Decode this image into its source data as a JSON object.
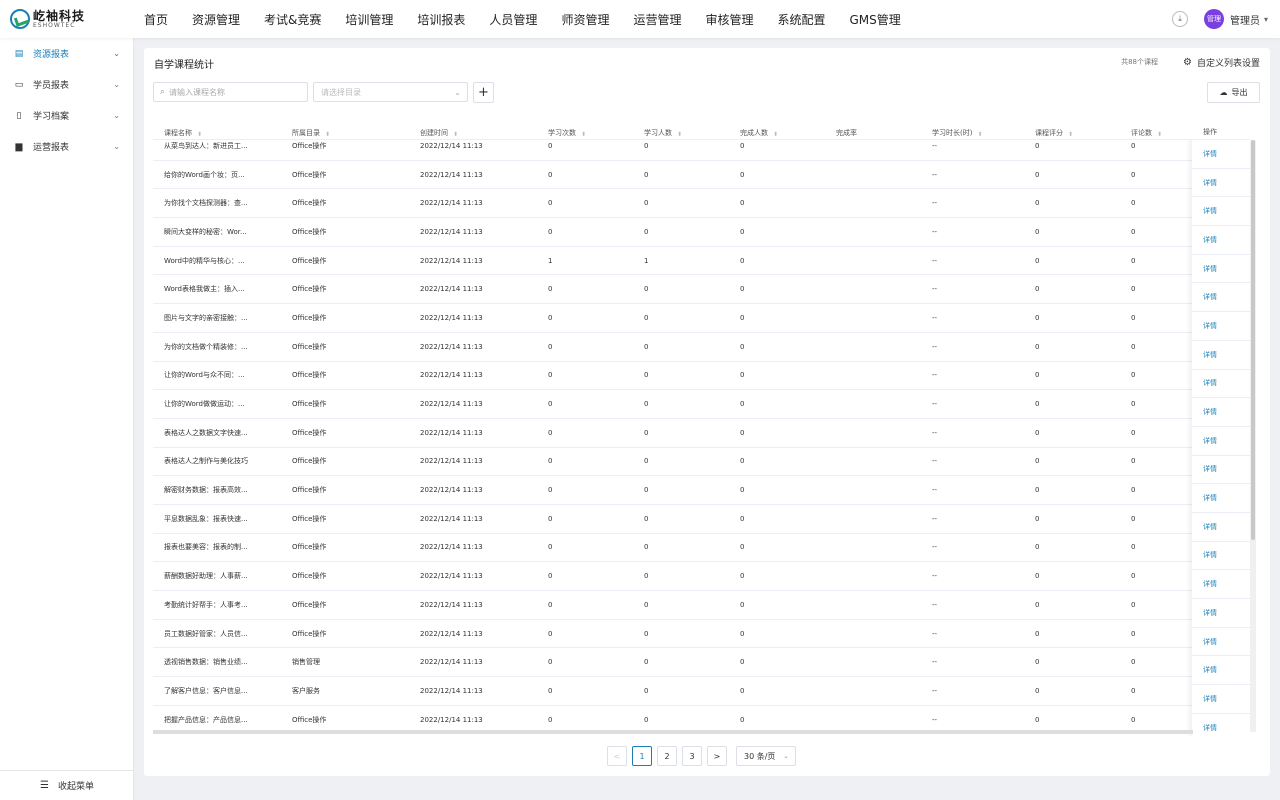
{
  "brand": {
    "name_cn": "屹袖科技",
    "name_en": "ESHOWTEC"
  },
  "nav": [
    "首页",
    "资源管理",
    "考试&竞赛",
    "培训管理",
    "培训报表",
    "人员管理",
    "师资管理",
    "运营管理",
    "审核管理",
    "系统配置",
    "GMS管理"
  ],
  "user": {
    "avatar_text": "管理",
    "name": "管理员"
  },
  "sidebar": {
    "items": [
      {
        "label": "资源报表",
        "icon": "document-icon",
        "active": true
      },
      {
        "label": "学员报表",
        "icon": "id-card-icon",
        "active": false
      },
      {
        "label": "学习档案",
        "icon": "file-icon",
        "active": false
      },
      {
        "label": "运营报表",
        "icon": "bar-chart-icon",
        "active": false
      }
    ],
    "collapse_label": "收起菜单"
  },
  "card": {
    "title": "自学课程统计",
    "total": "共88个课程",
    "custom_columns": "自定义列表设置",
    "search_placeholder": "请输入课程名称",
    "category_placeholder": "请选择目录",
    "export_label": "导出"
  },
  "table": {
    "columns": [
      "课程名称",
      "所属目录",
      "创建时间",
      "学习次数",
      "学习人数",
      "完成人数",
      "完成率",
      "学习时长(时)",
      "课程评分",
      "评论数"
    ],
    "operation_header": "操作",
    "detail_label": "详情",
    "rows": [
      [
        "从菜鸟到达人：新进员工...",
        "Office操作",
        "2022/12/14 11:13",
        "0",
        "0",
        "0",
        "",
        "--",
        "0",
        "0"
      ],
      [
        "给你的Word画个妆：页...",
        "Office操作",
        "2022/12/14 11:13",
        "0",
        "0",
        "0",
        "",
        "--",
        "0",
        "0"
      ],
      [
        "为你找个文档探测器：查...",
        "Office操作",
        "2022/12/14 11:13",
        "0",
        "0",
        "0",
        "",
        "--",
        "0",
        "0"
      ],
      [
        "瞬间大变样的秘密：Wor...",
        "Office操作",
        "2022/12/14 11:13",
        "0",
        "0",
        "0",
        "",
        "--",
        "0",
        "0"
      ],
      [
        "Word中的精华与核心：...",
        "Office操作",
        "2022/12/14 11:13",
        "1",
        "1",
        "0",
        "",
        "--",
        "0",
        "0"
      ],
      [
        "Word表格我做主：插入...",
        "Office操作",
        "2022/12/14 11:13",
        "0",
        "0",
        "0",
        "",
        "--",
        "0",
        "0"
      ],
      [
        "图片与文字的亲密接触：...",
        "Office操作",
        "2022/12/14 11:13",
        "0",
        "0",
        "0",
        "",
        "--",
        "0",
        "0"
      ],
      [
        "为你的文档做个精装修：...",
        "Office操作",
        "2022/12/14 11:13",
        "0",
        "0",
        "0",
        "",
        "--",
        "0",
        "0"
      ],
      [
        "让你的Word与众不同：...",
        "Office操作",
        "2022/12/14 11:13",
        "0",
        "0",
        "0",
        "",
        "--",
        "0",
        "0"
      ],
      [
        "让你的Word做做运动：...",
        "Office操作",
        "2022/12/14 11:13",
        "0",
        "0",
        "0",
        "",
        "--",
        "0",
        "0"
      ],
      [
        "表格达人之数据文字快速...",
        "Office操作",
        "2022/12/14 11:13",
        "0",
        "0",
        "0",
        "",
        "--",
        "0",
        "0"
      ],
      [
        "表格达人之制作与美化技巧",
        "Office操作",
        "2022/12/14 11:13",
        "0",
        "0",
        "0",
        "",
        "--",
        "0",
        "0"
      ],
      [
        "解密财务数据：报表高效...",
        "Office操作",
        "2022/12/14 11:13",
        "0",
        "0",
        "0",
        "",
        "--",
        "0",
        "0"
      ],
      [
        "平息数据乱象：报表快速...",
        "Office操作",
        "2022/12/14 11:13",
        "0",
        "0",
        "0",
        "",
        "--",
        "0",
        "0"
      ],
      [
        "报表也要美容：报表的制...",
        "Office操作",
        "2022/12/14 11:13",
        "0",
        "0",
        "0",
        "",
        "--",
        "0",
        "0"
      ],
      [
        "薪酬数据好助理：人事薪...",
        "Office操作",
        "2022/12/14 11:13",
        "0",
        "0",
        "0",
        "",
        "--",
        "0",
        "0"
      ],
      [
        "考勤统计好帮手：人事考...",
        "Office操作",
        "2022/12/14 11:13",
        "0",
        "0",
        "0",
        "",
        "--",
        "0",
        "0"
      ],
      [
        "员工数据好管家：人员信...",
        "Office操作",
        "2022/12/14 11:13",
        "0",
        "0",
        "0",
        "",
        "--",
        "0",
        "0"
      ],
      [
        "透视销售数据：销售业绩...",
        "销售管理",
        "2022/12/14 11:13",
        "0",
        "0",
        "0",
        "",
        "--",
        "0",
        "0"
      ],
      [
        "了解客户信息：客户信息...",
        "客户服务",
        "2022/12/14 11:13",
        "0",
        "0",
        "0",
        "",
        "--",
        "0",
        "0"
      ],
      [
        "把握产品信息：产品信息...",
        "Office操作",
        "2022/12/14 11:13",
        "0",
        "0",
        "0",
        "",
        "--",
        "0",
        "0"
      ]
    ]
  },
  "pagination": {
    "prev": "<",
    "pages": [
      "1",
      "2",
      "3"
    ],
    "current": "1",
    "next": ">",
    "page_size": "30 条/页"
  },
  "colors": {
    "accent": "#1a7fb8",
    "avatar": "#7a3fe0"
  }
}
